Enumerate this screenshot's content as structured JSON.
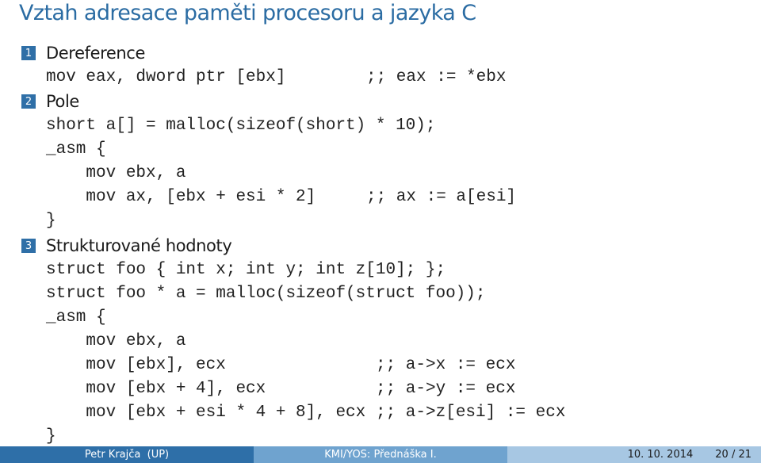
{
  "title": "Vztah adresace paměti procesoru a jazyka C",
  "sections": [
    {
      "number": "1",
      "label": "Dereference",
      "lines": [
        {
          "code": "mov eax, dword ptr [ebx]",
          "comment": ";; eax := *ebx"
        }
      ]
    },
    {
      "number": "2",
      "label": "Pole",
      "lines": [
        {
          "code": "short a[] = malloc(sizeof(short) * 10);",
          "comment": ""
        },
        {
          "code": "_asm {",
          "comment": ""
        },
        {
          "code": "    mov ebx, a",
          "comment": ""
        },
        {
          "code": "    mov ax, [ebx + esi * 2]",
          "comment": ";; ax := a[esi]"
        },
        {
          "code": "}",
          "comment": ""
        }
      ]
    },
    {
      "number": "3",
      "label": "Strukturované hodnoty",
      "lines": [
        {
          "code": "struct foo { int x; int y; int z[10]; };",
          "comment": ""
        },
        {
          "code": "struct foo * a = malloc(sizeof(struct foo));",
          "comment": ""
        },
        {
          "code": "_asm {",
          "comment": ""
        },
        {
          "code": "    mov ebx, a",
          "comment": ""
        },
        {
          "code": "    mov [ebx], ecx",
          "comment": ";; a->x := ecx"
        },
        {
          "code": "    mov [ebx + 4], ecx",
          "comment": ";; a->y := ecx"
        },
        {
          "code": "    mov [ebx + esi * 4 + 8], ecx",
          "comment": ";; a->z[esi] := ecx"
        },
        {
          "code": "}",
          "comment": ""
        }
      ]
    }
  ],
  "footer": {
    "author": "Petr Krajča  (UP)",
    "course": "KMI/YOS: Přednáška I.",
    "date": "10. 10. 2014",
    "page": "20 / 21"
  },
  "colors": {
    "title": "#2b6ca3",
    "footer_dark": "#2e6fa8",
    "footer_mid": "#6fa3cf",
    "footer_light": "#a7c7e3"
  }
}
